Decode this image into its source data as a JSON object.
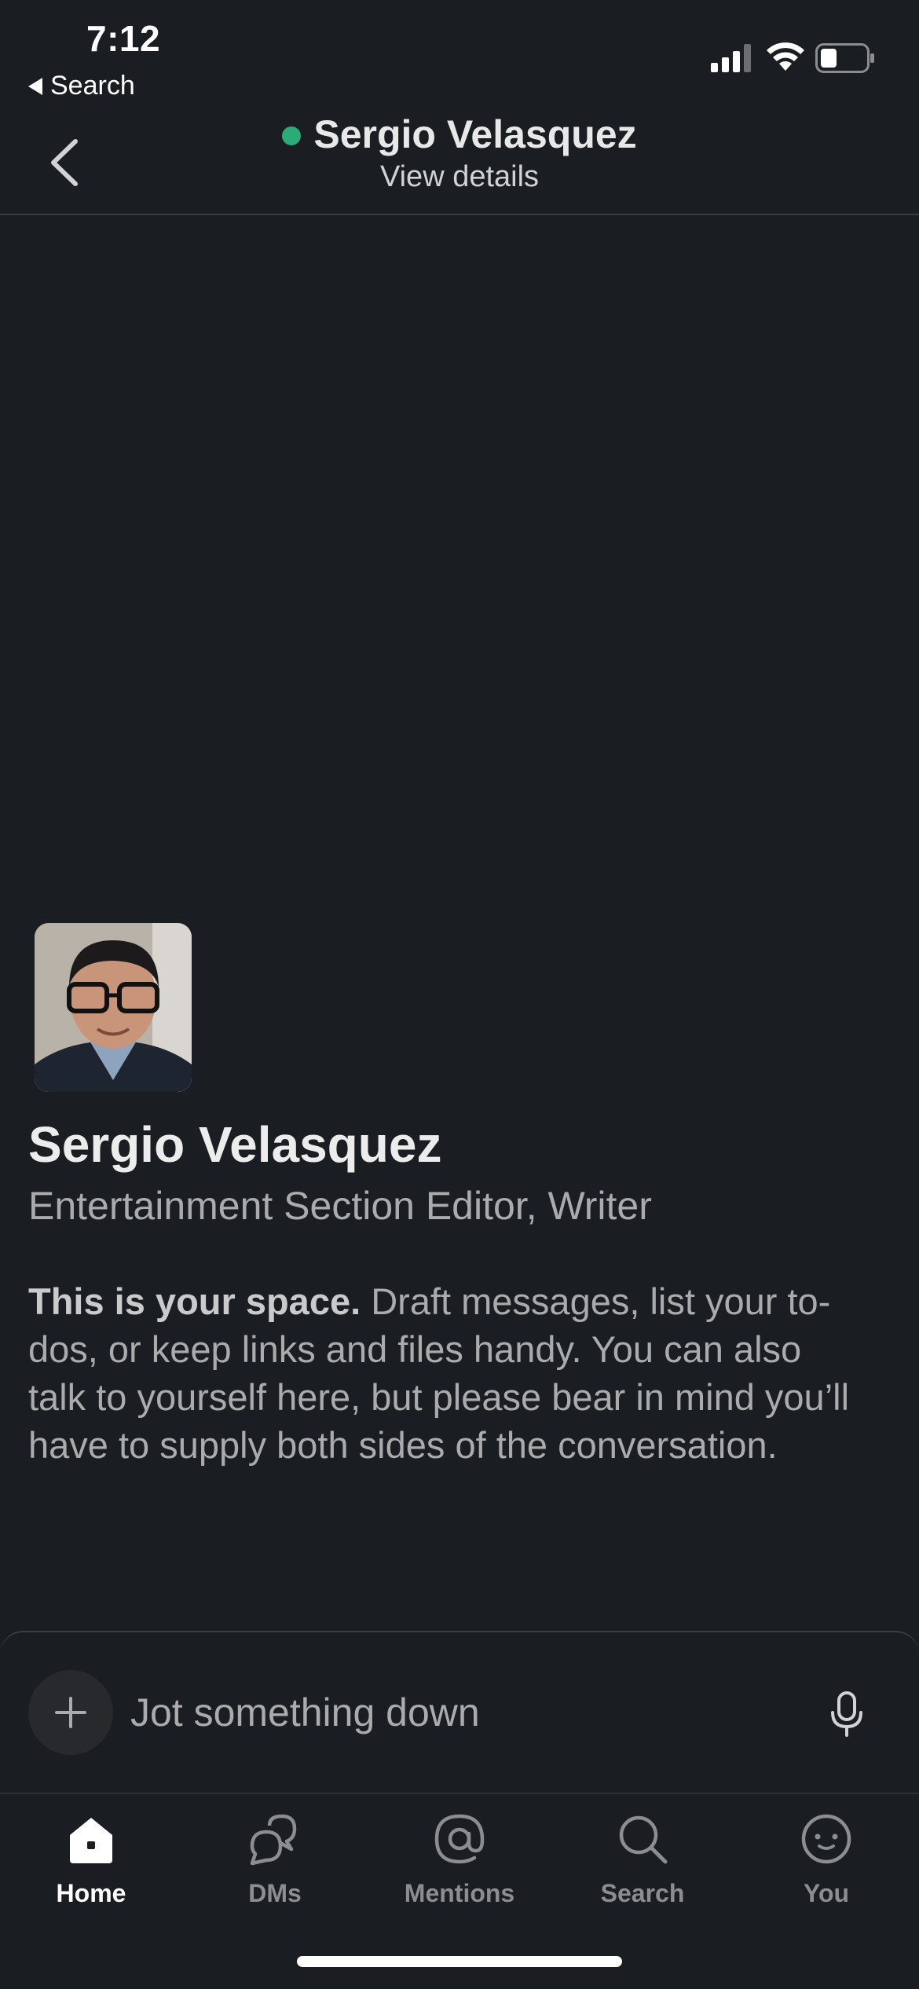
{
  "status_bar": {
    "time": "7:12",
    "back_label": "Search"
  },
  "header": {
    "name": "Sergio Velasquez",
    "subtitle": "View details",
    "presence_color": "#2bac76"
  },
  "profile": {
    "name": "Sergio Velasquez",
    "title": "Entertainment Section Editor, Writer"
  },
  "intro": {
    "lead": "This is your space.",
    "body": " Draft messages, list your to-dos, or keep links and files handy. You can also talk to yourself here, but please bear in mind you’ll have to supply both sides of the conversation."
  },
  "composer": {
    "placeholder": "Jot something down"
  },
  "tabs": [
    {
      "label": "Home",
      "icon": "home-icon",
      "active": true
    },
    {
      "label": "DMs",
      "icon": "dms-icon",
      "active": false
    },
    {
      "label": "Mentions",
      "icon": "mentions-icon",
      "active": false
    },
    {
      "label": "Search",
      "icon": "search-icon",
      "active": false
    },
    {
      "label": "You",
      "icon": "you-icon",
      "active": false
    }
  ],
  "colors": {
    "background": "#1a1d21",
    "presence": "#2bac76",
    "tab_active": "#ffffff",
    "tab_inactive": "#8b8d90"
  }
}
